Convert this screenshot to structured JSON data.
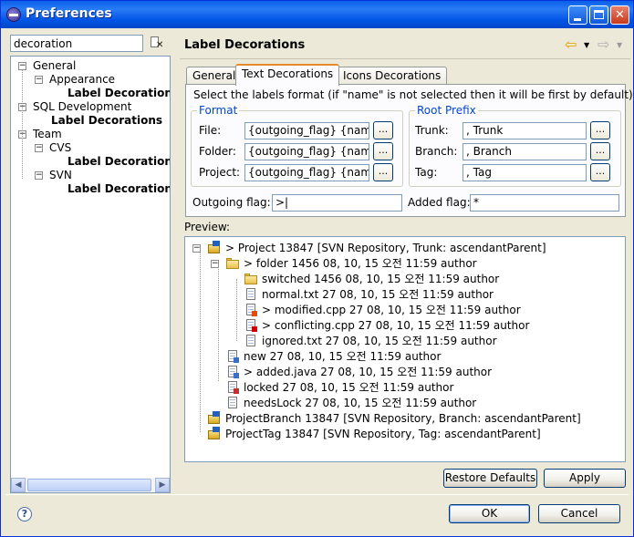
{
  "window": {
    "title": "Preferences"
  },
  "filter": {
    "value": "decoration"
  },
  "tree": [
    {
      "label": "General",
      "bold": false,
      "expander": "−",
      "depth": 0
    },
    {
      "label": "Appearance",
      "bold": false,
      "expander": "−",
      "depth": 1
    },
    {
      "label": "Label Decorations",
      "bold": true,
      "expander": "",
      "depth": 2
    },
    {
      "label": "SQL Development",
      "bold": false,
      "expander": "−",
      "depth": 0
    },
    {
      "label": "Label Decorations",
      "bold": true,
      "expander": "",
      "depth": 1
    },
    {
      "label": "Team",
      "bold": false,
      "expander": "−",
      "depth": 0
    },
    {
      "label": "CVS",
      "bold": false,
      "expander": "−",
      "depth": 1
    },
    {
      "label": "Label Decorations",
      "bold": true,
      "expander": "",
      "depth": 2
    },
    {
      "label": "SVN",
      "bold": false,
      "expander": "−",
      "depth": 1
    },
    {
      "label": "Label Decorations",
      "bold": true,
      "expander": "",
      "depth": 2
    }
  ],
  "page": {
    "title": "Label Decorations"
  },
  "tabs": [
    {
      "label": "General",
      "active": false
    },
    {
      "label": "Text Decorations",
      "active": true
    },
    {
      "label": "Icons Decorations",
      "active": false
    }
  ],
  "text_decorations": {
    "instruction": "Select the labels format (if \"name\" is not selected then it will be first by default):",
    "format_group": "Format",
    "root_prefix_group": "Root Prefix",
    "file_label": "File:",
    "folder_label": "Folder:",
    "project_label": "Project:",
    "file_value": "{outgoing_flag} {name}",
    "folder_value": "{outgoing_flag} {name}",
    "project_value": "{outgoing_flag} {name}",
    "trunk_label": "Trunk:",
    "branch_label": "Branch:",
    "tag_label": "Tag:",
    "trunk_value": ", Trunk",
    "branch_value": ", Branch",
    "tag_value": ", Tag",
    "browse_label": "...",
    "outgoing_label": "Outgoing flag:",
    "outgoing_value": ">|",
    "added_label": "Added flag:",
    "added_value": "*"
  },
  "preview": {
    "label": "Preview:",
    "rows": [
      {
        "text": "> Project 13847 [SVN Repository, Trunk: ascendantParent]",
        "icon": "project",
        "expander": "−"
      },
      {
        "text": "> folder 1456 08, 10, 15 오전 11:59 author",
        "icon": "folder",
        "expander": "−"
      },
      {
        "text": "switched 1456 08, 10, 15 오전 11:59 author",
        "icon": "folder",
        "expander": ""
      },
      {
        "text": "normal.txt 27 08, 10, 15 오전 11:59 author",
        "icon": "file",
        "expander": ""
      },
      {
        "text": "> modified.cpp 27 08, 10, 15 오전 11:59 author",
        "icon": "file-modified",
        "expander": ""
      },
      {
        "text": "> conflicting.cpp 27 08, 10, 15 오전 11:59 author",
        "icon": "file-conflict",
        "expander": ""
      },
      {
        "text": "ignored.txt 27 08, 10, 15 오전 11:59 author",
        "icon": "file",
        "expander": ""
      },
      {
        "text": "new 27 08, 10, 15 오전 11:59 author",
        "icon": "file-new",
        "expander": ""
      },
      {
        "text": "> added.java 27 08, 10, 15 오전 11:59 author",
        "icon": "file-added",
        "expander": ""
      },
      {
        "text": "locked 27 08, 10, 15 오전 11:59 author",
        "icon": "file-locked",
        "expander": ""
      },
      {
        "text": "needsLock 27 08, 10, 15 오전 11:59 author",
        "icon": "file",
        "expander": ""
      },
      {
        "text": "ProjectBranch 13847 [SVN Repository, Branch: ascendantParent]",
        "icon": "project",
        "expander": ""
      },
      {
        "text": "ProjectTag 13847 [SVN Repository, Tag: ascendantParent]",
        "icon": "project",
        "expander": ""
      }
    ]
  },
  "buttons": {
    "restore_defaults": "Restore Defaults",
    "apply": "Apply",
    "ok": "OK",
    "cancel": "Cancel"
  },
  "icons": {
    "app": "eclipse-icon",
    "help": "?",
    "back": "⇦",
    "forward": "⇨"
  }
}
